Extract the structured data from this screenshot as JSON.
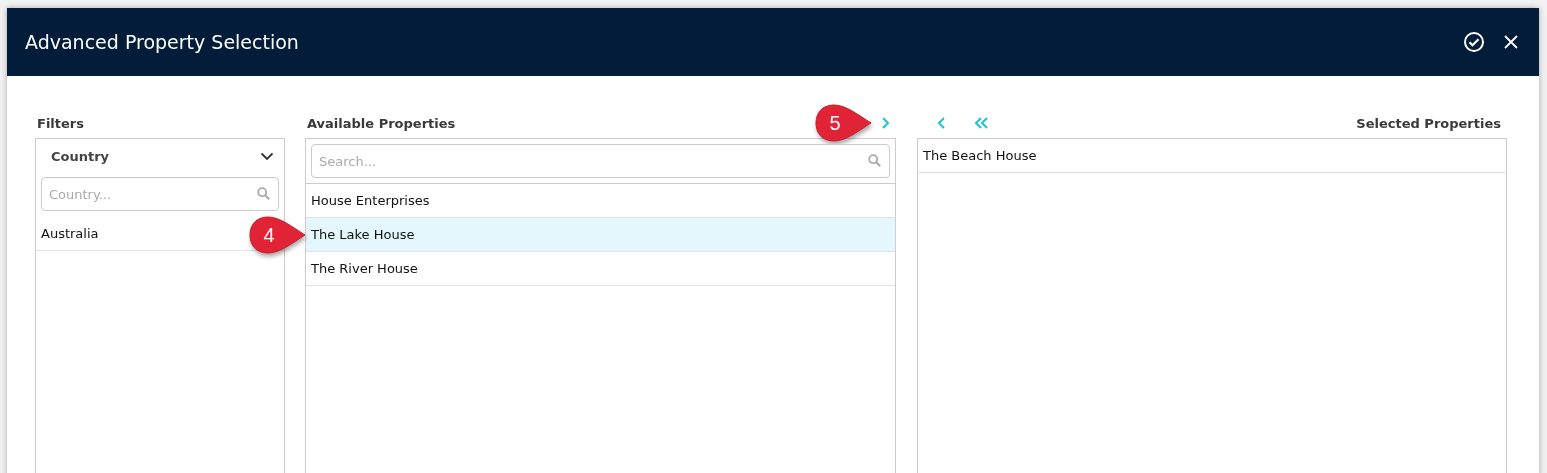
{
  "dialog": {
    "title": "Advanced Property Selection",
    "actions": [
      {
        "kind": "confirm"
      },
      {
        "kind": "close"
      }
    ]
  },
  "filters": {
    "heading": "Filters",
    "groups": [
      {
        "label": "Country",
        "expanded": true,
        "placeholder": "Country...",
        "items": [
          {
            "label": "Australia",
            "selected": false
          }
        ]
      }
    ]
  },
  "available": {
    "heading": "Available Properties",
    "placeholder": "Search...",
    "buttons": [
      {
        "kind": "move-right",
        "callout": "5"
      }
    ],
    "items": [
      {
        "label": "House Enterprises",
        "selected": false
      },
      {
        "label": "The Lake House",
        "selected": true,
        "callout": "4"
      },
      {
        "label": "The River House",
        "selected": false
      }
    ]
  },
  "chosen": {
    "heading": "Selected Properties",
    "buttons": [
      {
        "kind": "move-left"
      },
      {
        "kind": "move-all-left"
      }
    ],
    "items": [
      {
        "label": "The Beach House",
        "selected": false
      }
    ]
  }
}
